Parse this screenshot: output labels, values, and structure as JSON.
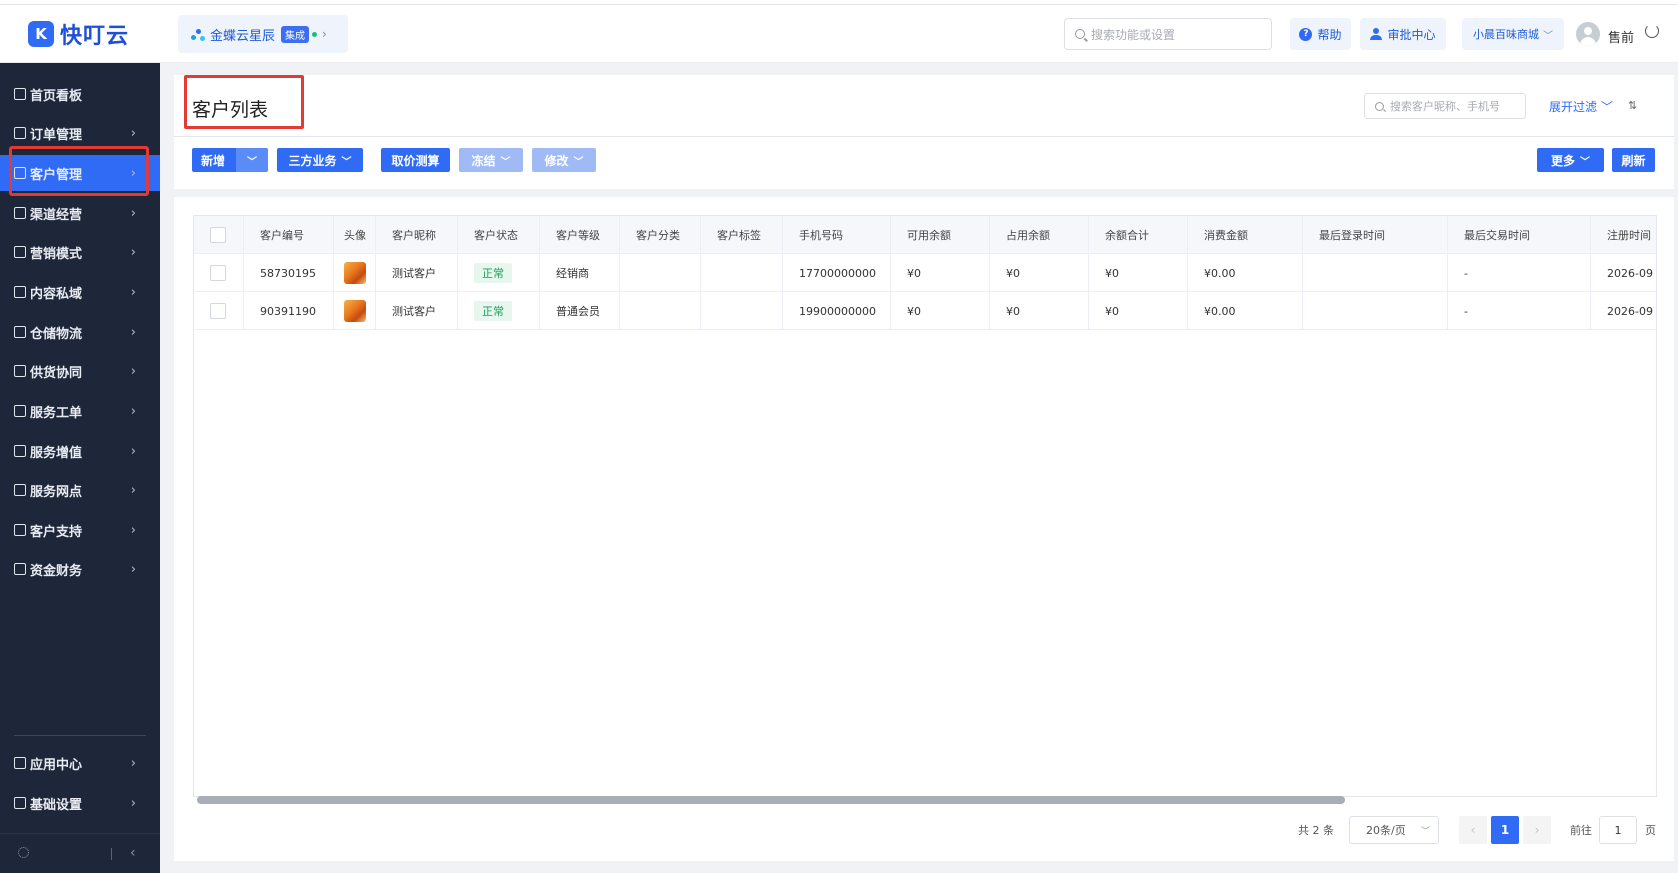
{
  "header": {
    "brand_logo": "K",
    "brand_name": "快叮云",
    "integration_name": "金蝶云星辰",
    "integration_badge": "集成",
    "search_placeholder": "搜索功能或设置",
    "help_label": "帮助",
    "approval_label": "审批中心",
    "store_name": "小晨百味商城",
    "user_name": "售前"
  },
  "sidebar": {
    "items": [
      {
        "label": "首页看板",
        "icon": "home-icon"
      },
      {
        "label": "订单管理",
        "icon": "order-icon"
      },
      {
        "label": "客户管理",
        "icon": "user-icon",
        "active": true
      },
      {
        "label": "渠道经营",
        "icon": "channel-icon"
      },
      {
        "label": "营销模式",
        "icon": "tag-icon"
      },
      {
        "label": "内容私域",
        "icon": "mail-icon"
      },
      {
        "label": "仓储物流",
        "icon": "warehouse-icon"
      },
      {
        "label": "供货协同",
        "icon": "supplier-icon"
      },
      {
        "label": "服务工单",
        "icon": "ticket-icon"
      },
      {
        "label": "服务增值",
        "icon": "bag-icon"
      },
      {
        "label": "服务网点",
        "icon": "store-icon"
      },
      {
        "label": "客户支持",
        "icon": "support-icon"
      },
      {
        "label": "资金财务",
        "icon": "finance-icon"
      }
    ],
    "bottom_items": [
      {
        "label": "应用中心",
        "icon": "app-icon"
      },
      {
        "label": "基础设置",
        "icon": "settings-icon"
      }
    ]
  },
  "page": {
    "title": "客户列表",
    "search_placeholder": "搜索客户昵称、手机号",
    "expand_filter": "展开过滤"
  },
  "toolbar": {
    "add": "新增",
    "third_party": "三方业务",
    "price_calc": "取价测算",
    "freeze": "冻结",
    "modify": "修改",
    "more": "更多",
    "refresh": "刷新"
  },
  "table": {
    "columns": [
      "客户编号",
      "头像",
      "客户昵称",
      "客户状态",
      "客户等级",
      "客户分类",
      "客户标签",
      "手机号码",
      "可用余额",
      "占用余额",
      "余额合计",
      "消费金额",
      "最后登录时间",
      "最后交易时间",
      "注册时间"
    ],
    "rows": [
      {
        "id": "58730195",
        "nickname": "测试客户",
        "status": "正常",
        "level": "经销商",
        "category": "",
        "tag": "",
        "phone": "17700000000",
        "available": "¥0",
        "occupied": "¥0",
        "total": "¥0",
        "spent": "¥0.00",
        "last_login": "",
        "last_trade": "-",
        "registered": "2026-09"
      },
      {
        "id": "90391190",
        "nickname": "测试客户",
        "status": "正常",
        "level": "普通会员",
        "category": "",
        "tag": "",
        "phone": "19900000000",
        "available": "¥0",
        "occupied": "¥0",
        "total": "¥0",
        "spent": "¥0.00",
        "last_login": "",
        "last_trade": "-",
        "registered": "2026-09"
      }
    ]
  },
  "pagination": {
    "total": "共 2 条",
    "page_size": "20条/页",
    "current_page": "1",
    "goto_label": "前往",
    "goto_value": "1",
    "page_unit": "页"
  }
}
